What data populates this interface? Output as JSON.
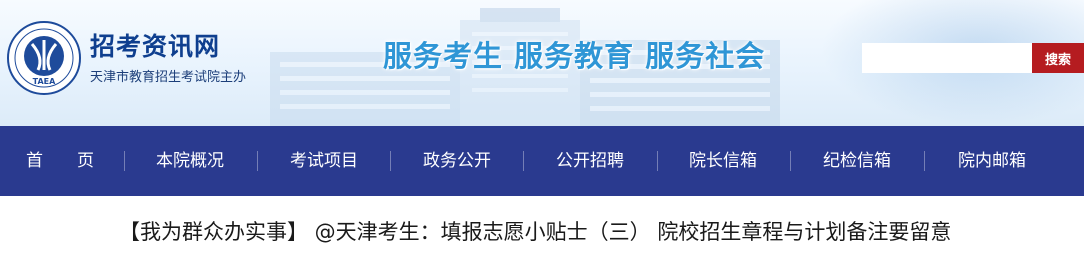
{
  "header": {
    "site_name": "招考资讯网",
    "organization": "天津市教育招生考试院主办",
    "logo_text": "TAEA",
    "slogan": "服务考生  服务教育  服务社会"
  },
  "search": {
    "placeholder": "",
    "value": "",
    "button_label": "搜索"
  },
  "nav": {
    "items": [
      {
        "label": "首　　页"
      },
      {
        "label": "本院概况"
      },
      {
        "label": "考试项目"
      },
      {
        "label": "政务公开"
      },
      {
        "label": "公开招聘"
      },
      {
        "label": "院长信箱"
      },
      {
        "label": "纪检信箱"
      },
      {
        "label": "院内邮箱"
      }
    ]
  },
  "article": {
    "title": "【我为群众办实事】 @天津考生：填报志愿小贴士（三） 院校招生章程与计划备注要留意"
  },
  "colors": {
    "nav_bg": "#2a3a8f",
    "search_button_bg": "#b51c20",
    "slogan": "#2f96d6",
    "site_name": "#0f3f8f"
  }
}
